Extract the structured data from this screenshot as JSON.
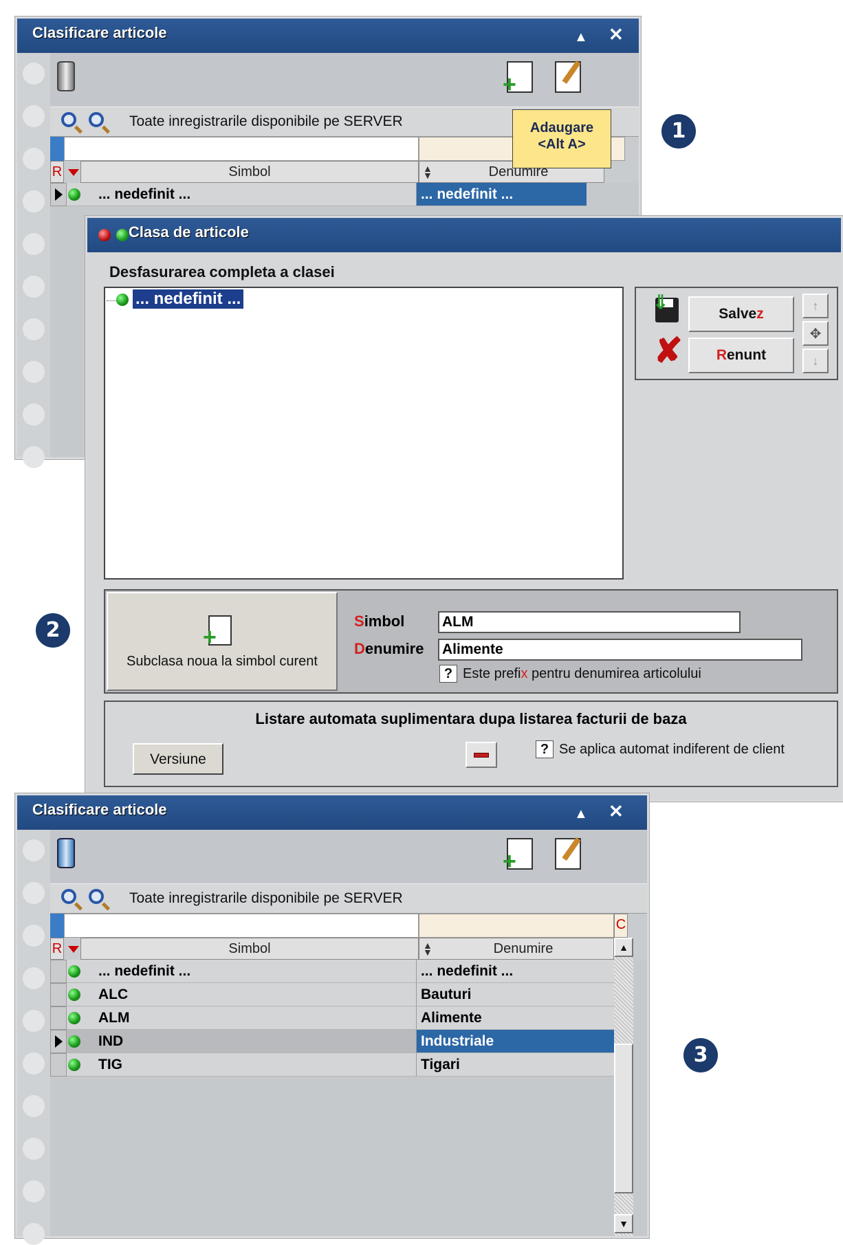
{
  "window1": {
    "title": "Clasificare articole",
    "search_text": "Toate inregistrarile disponibile pe SERVER",
    "tooltip_line1": "Adaugare",
    "tooltip_line2": "<Alt A>",
    "col_r": "R",
    "col_simbol": "Simbol",
    "col_denumire": "Denumire",
    "rows": [
      {
        "simbol": "... nedefinit ...",
        "denumire": "... nedefinit ..."
      }
    ]
  },
  "dialog": {
    "title": "Clasa de articole",
    "tree_label": "Desfasurarea completa a clasei",
    "tree_item": "... nedefinit ...",
    "save_label_pre": "Salve",
    "save_label_red": "z",
    "cancel_label_red": "R",
    "cancel_label_post": "enunt",
    "subclasa_label": "Subclasa noua la simbol curent",
    "simbol_label_red": "S",
    "simbol_label_post": "imbol",
    "simbol_value": "ALM",
    "denumire_label_red": "D",
    "denumire_label_post": "enumire",
    "denumire_value": "Alimente",
    "prefix_q": "?",
    "prefix_text_pre": "Este prefi",
    "prefix_text_red": "x",
    "prefix_text_post": " pentru denumirea articolului",
    "listare_title": "Listare automata suplimentara dupa listarea facturii de baza",
    "versiune_label": "Versiune",
    "aplica_q": "?",
    "aplica_text": "Se aplica automat indiferent de client"
  },
  "window3": {
    "title": "Clasificare articole",
    "search_text": "Toate inregistrarile disponibile pe SERVER",
    "col_r": "R",
    "col_c": "C",
    "col_simbol": "Simbol",
    "col_denumire": "Denumire",
    "rows": [
      {
        "simbol": "... nedefinit ...",
        "denumire": "... nedefinit ..."
      },
      {
        "simbol": "ALC",
        "denumire": "Bauturi"
      },
      {
        "simbol": "ALM",
        "denumire": "Alimente"
      },
      {
        "simbol": "IND",
        "denumire": "Industriale"
      },
      {
        "simbol": "TIG",
        "denumire": "Tigari"
      }
    ]
  },
  "badges": {
    "one": "1",
    "two": "2",
    "three": "3"
  },
  "colors": {
    "titlebar": "#2e5a96",
    "selection": "#2c67a6",
    "badge": "#1c3a6b"
  }
}
